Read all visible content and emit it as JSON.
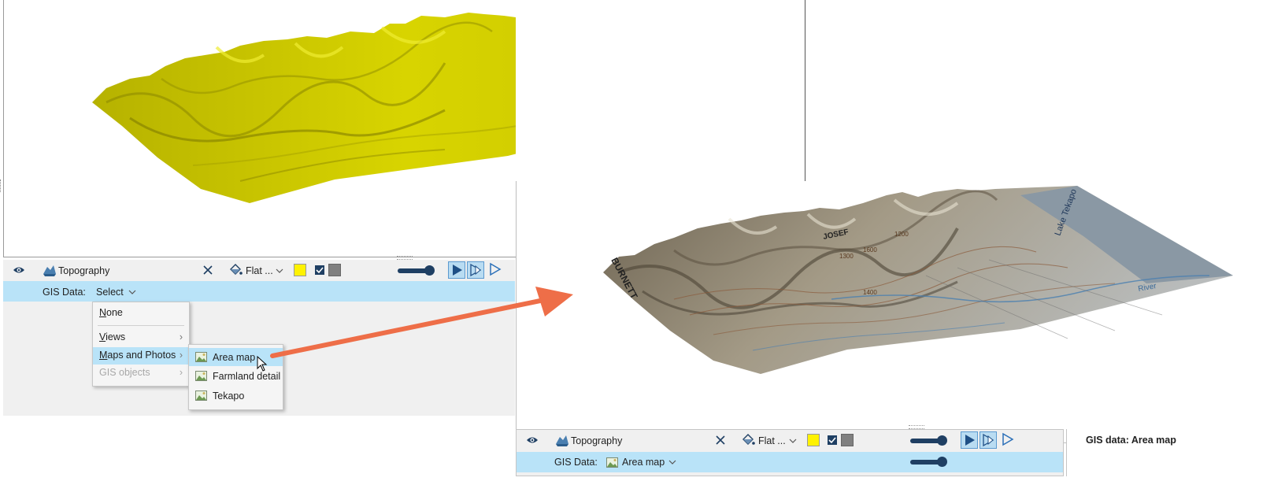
{
  "left_panel": {
    "object_name": "Topography",
    "shading_label": "Flat ...",
    "gis_label": "GIS Data:",
    "gis_value": "Select",
    "swatch_color": "#fff200",
    "backface_color": "#808080"
  },
  "gis_menu": {
    "items": [
      {
        "label": "None",
        "mnemonic": "N",
        "rest": "one"
      },
      {
        "label": "Views",
        "mnemonic": "V",
        "rest": "iews"
      },
      {
        "label": "Maps and Photos",
        "mnemonic": "M",
        "rest": "aps and Photos"
      },
      {
        "label": "GIS objects",
        "mnemonic": "",
        "rest": "GIS objects"
      }
    ]
  },
  "maps_submenu": {
    "items": [
      "Area map",
      "Farmland detail",
      "Tekapo"
    ]
  },
  "right_panel": {
    "object_name": "Topography",
    "shading_label": "Flat ...",
    "gis_label": "GIS Data:",
    "gis_value": "Area map",
    "swatch_color": "#fff200",
    "backface_color": "#808080"
  },
  "side_info": {
    "text": "GIS data: Area map"
  },
  "map_labels": {
    "label_burnett": "BURNETT",
    "label_josef": "JOSEF",
    "label_tekapo": "Lake Tekapo",
    "label_river": "River",
    "label_contour1": "1600",
    "label_contour2": "1300",
    "label_contour3": "1200",
    "label_contour4": "1400"
  },
  "colors": {
    "selection": "#b9e3f8",
    "arrow": "#ee6e48",
    "terrain_yellow": "#c8c400",
    "lake": "#8a98a4"
  }
}
